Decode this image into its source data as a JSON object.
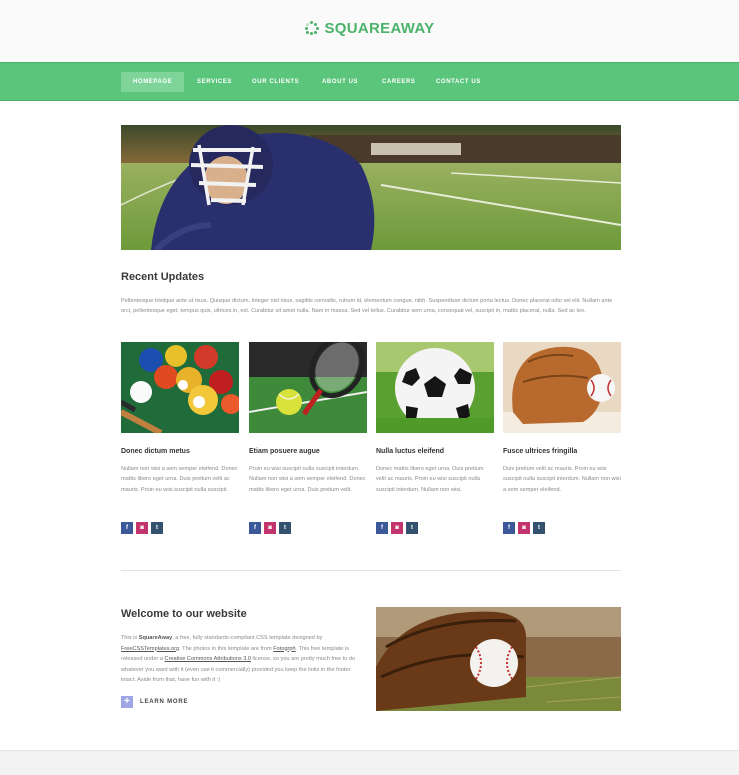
{
  "brand": {
    "name": "SQUAREAWAY",
    "accent": "#4bb36a",
    "nav_color": "#5bc57b"
  },
  "nav": {
    "items": [
      {
        "label": "HOMEPAGE",
        "active": true
      },
      {
        "label": "SERVICES",
        "active": false
      },
      {
        "label": "OUR CLIENTS",
        "active": false
      },
      {
        "label": "ABOUT US",
        "active": false
      },
      {
        "label": "CAREERS",
        "active": false
      },
      {
        "label": "CONTACT US",
        "active": false
      }
    ]
  },
  "recent": {
    "title": "Recent Updates",
    "text": "Pellentesque tristique ante ut risus. Quisque dictum. Integer nisl risus, sagittis convallis, rutrum id, elementum congue, nibh. Suspendisse dictum porta lectus. Donec placerat odio vel elit. Nullam ante orci, pellentesque eget, tempus quis, ultrices in, est. Curabitur sit amet nulla. Nam in massa. Sed vel tellus. Curabitur sem urna, consequat vel, suscipit in, mattis placerat, nulla. Sed ac leo."
  },
  "cards": [
    {
      "title": "Donec dictum metus",
      "image": "billiard-balls",
      "text": "Nullam non wisi a sem semper eleifend. Donec mattis libero eget urna. Duis pretium velit ac mauris. Proin eu wisi suscipit nulla suscipit."
    },
    {
      "title": "Etiam posuere augue",
      "image": "tennis-racket-ball",
      "text": "Proin eu wisi suscipit nulla suscipit interdum. Nullam non wisi a sem semper eleifend. Donec mattis libero eget urna. Duis pretium velit."
    },
    {
      "title": "Nulla luctus eleifend",
      "image": "soccer-ball",
      "text": "Donec mattis libero eget urna. Duis pretium velit ac mauris. Proin eu wisi suscipit nulla suscipit interdum. Nullam non wisi."
    },
    {
      "title": "Fusce ultrices fringilla",
      "image": "baseball-glove",
      "text": "Duis pretium velit ac mauris. Proin eu wisi suscipit nulla suscipit interdum. Nullam non wisi a sem semper eleifend."
    }
  ],
  "social": {
    "facebook": "f",
    "instagram": "◙",
    "tumblr": "t"
  },
  "welcome": {
    "title": "Welcome to our website",
    "p1": "This is ",
    "name": "SquareAway",
    "p2": ", a free, fully standards-compliant CSS template designed by ",
    "link1": "FreeCSSTemplates.org",
    "p3": ". The photos in this template are from ",
    "link2": "Fotogrph",
    "p4": ". This free template is released under a ",
    "link3": "Creative Commons Attributions 3.0",
    "p5": " license, so you are pretty much free to do whatever you want with it (even use it commercially) provided you keep the links in the footer intact. Aside from that, have fun with it :)",
    "learn_more": "LEARN MORE",
    "learn_more_icon": "+",
    "image": "baseball-in-glove"
  }
}
